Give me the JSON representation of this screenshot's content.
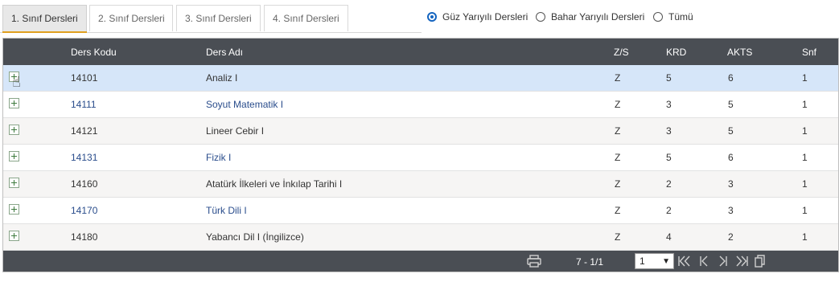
{
  "tabs": [
    {
      "label": "1. Sınıf Dersleri",
      "active": true
    },
    {
      "label": "2. Sınıf Dersleri",
      "active": false
    },
    {
      "label": "3. Sınıf Dersleri",
      "active": false
    },
    {
      "label": "4. Sınıf Dersleri",
      "active": false
    }
  ],
  "filters": [
    {
      "label": "Güz Yarıyılı Dersleri",
      "selected": true
    },
    {
      "label": "Bahar Yarıyılı Dersleri",
      "selected": false
    },
    {
      "label": "Tümü",
      "selected": false
    }
  ],
  "table": {
    "columns": {
      "code": "Ders Kodu",
      "name": "Ders Adı",
      "zs": "Z/S",
      "krd": "KRD",
      "akts": "AKTS",
      "snf": "Snf"
    },
    "rows": [
      {
        "code": "14101",
        "name": "Analiz I",
        "zs": "Z",
        "krd": "5",
        "akts": "6",
        "snf": "1"
      },
      {
        "code": "14111",
        "name": "Soyut Matematik I",
        "zs": "Z",
        "krd": "3",
        "akts": "5",
        "snf": "1"
      },
      {
        "code": "14121",
        "name": "Lineer Cebir I",
        "zs": "Z",
        "krd": "3",
        "akts": "5",
        "snf": "1"
      },
      {
        "code": "14131",
        "name": "Fizik I",
        "zs": "Z",
        "krd": "5",
        "akts": "6",
        "snf": "1"
      },
      {
        "code": "14160",
        "name": "Atatürk İlkeleri ve İnkılap Tarihi I",
        "zs": "Z",
        "krd": "2",
        "akts": "3",
        "snf": "1"
      },
      {
        "code": "14170",
        "name": "Türk Dili I",
        "zs": "Z",
        "krd": "2",
        "akts": "3",
        "snf": "1"
      },
      {
        "code": "14180",
        "name": "Yabancı Dil I (İngilizce)",
        "zs": "Z",
        "krd": "4",
        "akts": "2",
        "snf": "1"
      }
    ]
  },
  "pager": {
    "info": "7 - 1/1",
    "page_value": "1"
  },
  "colors": {
    "header_bg": "#4a4e54",
    "selected_row": "#d6e6f9",
    "radio_accent": "#1565c0",
    "tab_accent": "#e0a020"
  },
  "icons": [
    "plus-box-icon",
    "hand-cursor-icon",
    "print-icon",
    "first-page-icon",
    "prev-page-icon",
    "next-page-icon",
    "last-page-icon",
    "copy-icon"
  ]
}
